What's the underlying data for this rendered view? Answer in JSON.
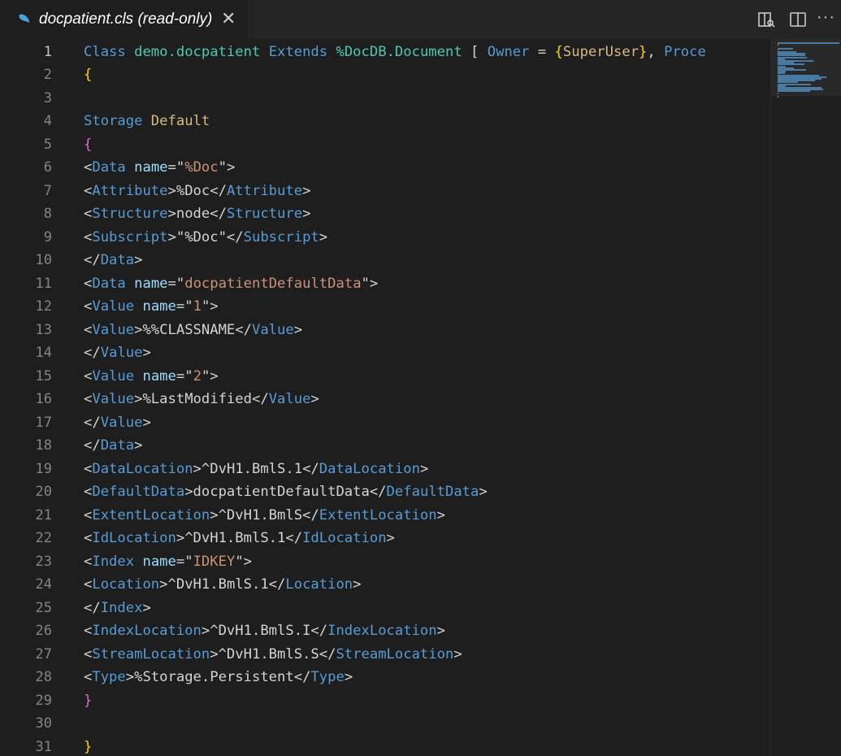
{
  "tab": {
    "title": "docpatient.cls (read-only)",
    "close_glyph": "✕",
    "icon": "file-icon"
  },
  "actions": [
    {
      "name": "open-preview-icon"
    },
    {
      "name": "split-editor-icon"
    },
    {
      "name": "more-actions-icon",
      "glyph": "···"
    }
  ],
  "colors": {
    "keyword": "#569cd6",
    "class_name": "#4ec9b0",
    "property": "#9cdcfe",
    "string": "#ce9178",
    "text": "#d4d4d4",
    "brace_gold": "#ffd700",
    "brace_pink": "#da70d6",
    "tag": "#569cd6",
    "attr": "#9cdcfe",
    "punct": "#d4d4d4",
    "value": "#d7ba7d"
  },
  "editor": {
    "active_line": 1,
    "lines": [
      [
        {
          "t": "Class",
          "c": "keyword"
        },
        {
          "t": " "
        },
        {
          "t": "demo.docpatient",
          "c": "class_name"
        },
        {
          "t": " "
        },
        {
          "t": "Extends",
          "c": "keyword"
        },
        {
          "t": " "
        },
        {
          "t": "%DocDB.Document",
          "c": "class_name"
        },
        {
          "t": " [ "
        },
        {
          "t": "Owner",
          "c": "keyword"
        },
        {
          "t": " = "
        },
        {
          "t": "{",
          "c": "brace_gold"
        },
        {
          "t": "SuperUser",
          "c": "value"
        },
        {
          "t": "}",
          "c": "brace_gold"
        },
        {
          "t": ", "
        },
        {
          "t": "Proce",
          "c": "keyword"
        }
      ],
      [
        {
          "t": "{",
          "c": "brace_gold"
        }
      ],
      [],
      [
        {
          "t": "Storage",
          "c": "keyword"
        },
        {
          "t": " "
        },
        {
          "t": "Default",
          "c": "value"
        }
      ],
      [
        {
          "t": "{",
          "c": "brace_pink"
        }
      ],
      [
        {
          "t": "<"
        },
        {
          "t": "Data",
          "c": "tag"
        },
        {
          "t": " "
        },
        {
          "t": "name",
          "c": "attr"
        },
        {
          "t": "=\""
        },
        {
          "t": "%Doc",
          "c": "string"
        },
        {
          "t": "\">"
        }
      ],
      [
        {
          "t": "<"
        },
        {
          "t": "Attribute",
          "c": "tag"
        },
        {
          "t": ">%Doc</"
        },
        {
          "t": "Attribute",
          "c": "tag"
        },
        {
          "t": ">"
        }
      ],
      [
        {
          "t": "<"
        },
        {
          "t": "Structure",
          "c": "tag"
        },
        {
          "t": ">node</"
        },
        {
          "t": "Structure",
          "c": "tag"
        },
        {
          "t": ">"
        }
      ],
      [
        {
          "t": "<"
        },
        {
          "t": "Subscript",
          "c": "tag"
        },
        {
          "t": ">\"%Doc\"</"
        },
        {
          "t": "Subscript",
          "c": "tag"
        },
        {
          "t": ">"
        }
      ],
      [
        {
          "t": "</"
        },
        {
          "t": "Data",
          "c": "tag"
        },
        {
          "t": ">"
        }
      ],
      [
        {
          "t": "<"
        },
        {
          "t": "Data",
          "c": "tag"
        },
        {
          "t": " "
        },
        {
          "t": "name",
          "c": "attr"
        },
        {
          "t": "=\""
        },
        {
          "t": "docpatientDefaultData",
          "c": "string"
        },
        {
          "t": "\">"
        }
      ],
      [
        {
          "t": "<"
        },
        {
          "t": "Value",
          "c": "tag"
        },
        {
          "t": " "
        },
        {
          "t": "name",
          "c": "attr"
        },
        {
          "t": "=\""
        },
        {
          "t": "1",
          "c": "string"
        },
        {
          "t": "\">"
        }
      ],
      [
        {
          "t": "<"
        },
        {
          "t": "Value",
          "c": "tag"
        },
        {
          "t": ">%%CLASSNAME</"
        },
        {
          "t": "Value",
          "c": "tag"
        },
        {
          "t": ">"
        }
      ],
      [
        {
          "t": "</"
        },
        {
          "t": "Value",
          "c": "tag"
        },
        {
          "t": ">"
        }
      ],
      [
        {
          "t": "<"
        },
        {
          "t": "Value",
          "c": "tag"
        },
        {
          "t": " "
        },
        {
          "t": "name",
          "c": "attr"
        },
        {
          "t": "=\""
        },
        {
          "t": "2",
          "c": "string"
        },
        {
          "t": "\">"
        }
      ],
      [
        {
          "t": "<"
        },
        {
          "t": "Value",
          "c": "tag"
        },
        {
          "t": ">%LastModified</"
        },
        {
          "t": "Value",
          "c": "tag"
        },
        {
          "t": ">"
        }
      ],
      [
        {
          "t": "</"
        },
        {
          "t": "Value",
          "c": "tag"
        },
        {
          "t": ">"
        }
      ],
      [
        {
          "t": "</"
        },
        {
          "t": "Data",
          "c": "tag"
        },
        {
          "t": ">"
        }
      ],
      [
        {
          "t": "<"
        },
        {
          "t": "DataLocation",
          "c": "tag"
        },
        {
          "t": ">^DvH1.BmlS.1</"
        },
        {
          "t": "DataLocation",
          "c": "tag"
        },
        {
          "t": ">"
        }
      ],
      [
        {
          "t": "<"
        },
        {
          "t": "DefaultData",
          "c": "tag"
        },
        {
          "t": ">docpatientDefaultData</"
        },
        {
          "t": "DefaultData",
          "c": "tag"
        },
        {
          "t": ">"
        }
      ],
      [
        {
          "t": "<"
        },
        {
          "t": "ExtentLocation",
          "c": "tag"
        },
        {
          "t": ">^DvH1.BmlS</"
        },
        {
          "t": "ExtentLocation",
          "c": "tag"
        },
        {
          "t": ">"
        }
      ],
      [
        {
          "t": "<"
        },
        {
          "t": "IdLocation",
          "c": "tag"
        },
        {
          "t": ">^DvH1.BmlS.1</"
        },
        {
          "t": "IdLocation",
          "c": "tag"
        },
        {
          "t": ">"
        }
      ],
      [
        {
          "t": "<"
        },
        {
          "t": "Index",
          "c": "tag"
        },
        {
          "t": " "
        },
        {
          "t": "name",
          "c": "attr"
        },
        {
          "t": "=\""
        },
        {
          "t": "IDKEY",
          "c": "string"
        },
        {
          "t": "\">"
        }
      ],
      [
        {
          "t": "<"
        },
        {
          "t": "Location",
          "c": "tag"
        },
        {
          "t": ">^DvH1.BmlS.1</"
        },
        {
          "t": "Location",
          "c": "tag"
        },
        {
          "t": ">"
        }
      ],
      [
        {
          "t": "</"
        },
        {
          "t": "Index",
          "c": "tag"
        },
        {
          "t": ">"
        }
      ],
      [
        {
          "t": "<"
        },
        {
          "t": "IndexLocation",
          "c": "tag"
        },
        {
          "t": ">^DvH1.BmlS.I</"
        },
        {
          "t": "IndexLocation",
          "c": "tag"
        },
        {
          "t": ">"
        }
      ],
      [
        {
          "t": "<"
        },
        {
          "t": "StreamLocation",
          "c": "tag"
        },
        {
          "t": ">^DvH1.BmlS.S</"
        },
        {
          "t": "StreamLocation",
          "c": "tag"
        },
        {
          "t": ">"
        }
      ],
      [
        {
          "t": "<"
        },
        {
          "t": "Type",
          "c": "tag"
        },
        {
          "t": ">%Storage.Persistent</"
        },
        {
          "t": "Type",
          "c": "tag"
        },
        {
          "t": ">"
        }
      ],
      [
        {
          "t": "}",
          "c": "brace_pink"
        }
      ],
      [],
      [
        {
          "t": "}",
          "c": "brace_gold"
        }
      ]
    ]
  }
}
